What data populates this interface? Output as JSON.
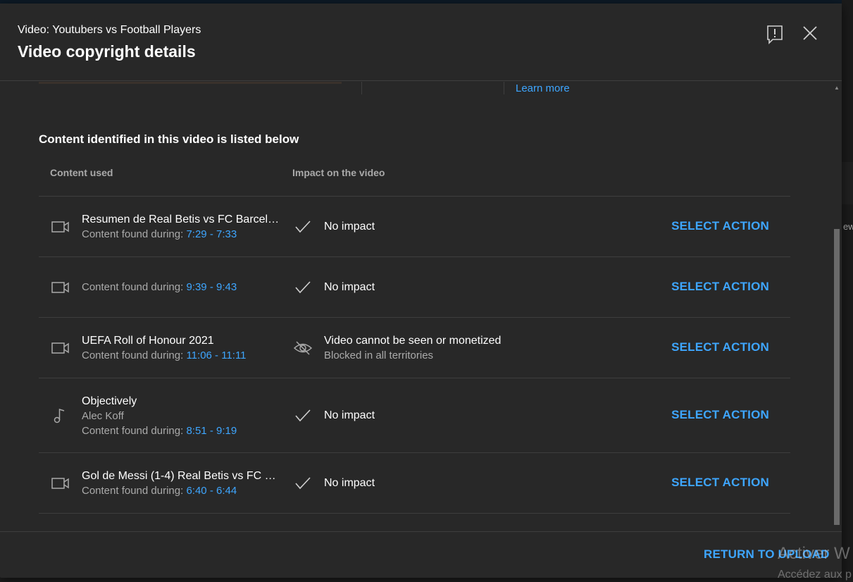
{
  "dialog": {
    "subtitle": "Video: Youtubers vs Football Players",
    "title": "Video copyright details",
    "learn_more": "Learn more",
    "section_title": "Content identified in this video is listed below",
    "columns": {
      "content": "Content used",
      "impact": "Impact on the video"
    },
    "rows": [
      {
        "type": "video",
        "name": "Resumen de Real Betis vs FC Barcelo…",
        "artist": "",
        "found_label": "Content found during: ",
        "time": "7:29 - 7:33",
        "impact_icon": "check-icon",
        "impact": "No impact",
        "impact_sub": "",
        "action": "SELECT ACTION"
      },
      {
        "type": "video",
        "name": "",
        "artist": "",
        "found_label": "Content found during: ",
        "time": "9:39 - 9:43",
        "impact_icon": "check-icon",
        "impact": "No impact",
        "impact_sub": "",
        "action": "SELECT ACTION"
      },
      {
        "type": "video",
        "name": "UEFA Roll of Honour 2021",
        "artist": "",
        "found_label": "Content found during: ",
        "time": "11:06 - 11:11",
        "impact_icon": "eye-off-icon",
        "impact": "Video cannot be seen or monetized",
        "impact_sub": "Blocked in all territories",
        "action": "SELECT ACTION"
      },
      {
        "type": "music",
        "name": "Objectively",
        "artist": "Alec Koff",
        "found_label": "Content found during: ",
        "time": "8:51 - 9:19",
        "impact_icon": "check-icon",
        "impact": "No impact",
        "impact_sub": "",
        "action": "SELECT ACTION"
      },
      {
        "type": "video",
        "name": "Gol de Messi (1-4) Real Betis vs FC B…",
        "artist": "",
        "found_label": "Content found during: ",
        "time": "6:40 - 6:44",
        "impact_icon": "check-icon",
        "impact": "No impact",
        "impact_sub": "",
        "action": "SELECT ACTION"
      }
    ],
    "footer_button": "RETURN TO UPLOAD"
  },
  "watermark": {
    "line1": "Activer W",
    "line2": "Accédez aux p"
  },
  "background_fragment": "ew",
  "colors": {
    "accent": "#3ea6ff",
    "dialog_bg": "#282828",
    "divider": "#3e3e3e",
    "muted_text": "#aaaaaa"
  }
}
